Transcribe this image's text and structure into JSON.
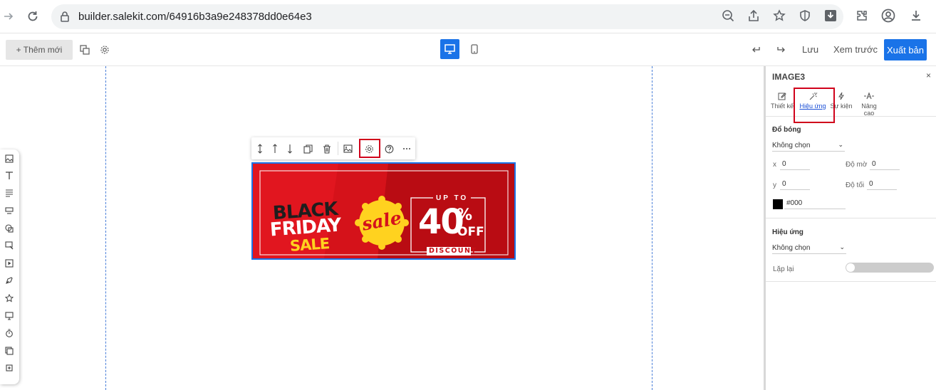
{
  "browser": {
    "url": "builder.salekit.com/64916b3a9e248378dd0e64e3"
  },
  "toolbar": {
    "add_label": "+ Thêm mới",
    "save_label": "Lưu",
    "preview_label": "Xem trước",
    "publish_label": "Xuất bản"
  },
  "banner": {
    "line1": "BLACK",
    "line2": "FRIDAY",
    "line3": "SALE",
    "badge": "sale",
    "upto": "UP TO",
    "percent": "40",
    "percent_sign": "%",
    "off": "OFF",
    "discount": "DISCOUNT",
    "colors": {
      "red": "#d4111c",
      "dark_red": "#b80c12",
      "yellow": "#ffd21f"
    }
  },
  "panel": {
    "title": "IMAGE3",
    "close": "×",
    "tabs": [
      {
        "label": "Thiết kế"
      },
      {
        "label": "Hiệu ứng"
      },
      {
        "label": "Sự kiện"
      },
      {
        "label": "Nâng cao"
      }
    ],
    "shadow_section": "Đổ bóng",
    "shadow_select": "Không chọn",
    "x_label": "x",
    "x_value": "0",
    "y_label": "y",
    "y_value": "0",
    "blur_label": "Độ mờ",
    "blur_value": "0",
    "dark_label": "Độ tối",
    "dark_value": "0",
    "color_value": "#000",
    "effect_section": "Hiệu ứng",
    "effect_select": "Không chọn",
    "repeat_label": "Lặp lại"
  },
  "accent_color": "#1a73e8",
  "highlight_color": "#d0021b"
}
